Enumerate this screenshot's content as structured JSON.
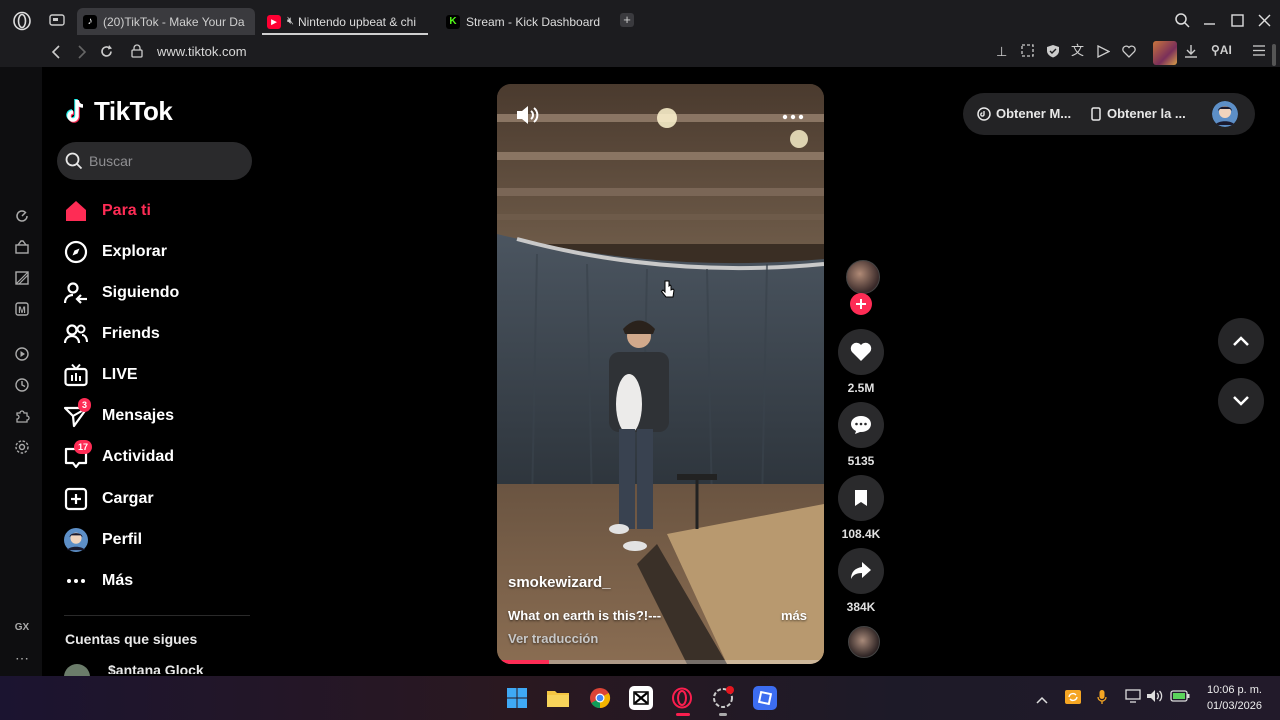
{
  "browser": {
    "tabs": [
      {
        "title": "(20)TikTok - Make Your Da",
        "active": true
      },
      {
        "title": "Nintendo upbeat & chi",
        "active": false,
        "muted": true
      },
      {
        "title": "Stream - Kick Dashboard",
        "active": false
      }
    ],
    "url": "www.tiktok.com"
  },
  "tiktok": {
    "logo_text": "TikTok",
    "search_placeholder": "Buscar",
    "nav": [
      {
        "label": "Para ti",
        "icon": "home-icon",
        "active": true
      },
      {
        "label": "Explorar",
        "icon": "compass-icon"
      },
      {
        "label": "Siguiendo",
        "icon": "following-icon"
      },
      {
        "label": "Friends",
        "icon": "friends-icon"
      },
      {
        "label": "LIVE",
        "icon": "live-icon"
      },
      {
        "label": "Mensajes",
        "icon": "messages-icon",
        "badge": "3"
      },
      {
        "label": "Actividad",
        "icon": "activity-icon",
        "badge": "17"
      },
      {
        "label": "Cargar",
        "icon": "upload-icon"
      },
      {
        "label": "Perfil",
        "icon": "avatar"
      },
      {
        "label": "Más",
        "icon": "more-icon"
      }
    ],
    "following_title": "Cuentas que sigues",
    "following_first": "$antana Glock"
  },
  "video": {
    "author": "smokewizard_",
    "caption": "What on earth is this?!---",
    "more_label": "más",
    "translate_label": "Ver traducción",
    "progress": 0.16
  },
  "actions": {
    "likes": "2.5M",
    "comments": "5135",
    "saves": "108.4K",
    "shares": "384K"
  },
  "topright": {
    "get_app": "Obtener M...",
    "get_desktop": "Obtener la ..."
  },
  "taskbar": {
    "time": "10:06 p. m.",
    "date": "01/03/2026"
  },
  "sidebar_opera": {
    "gx_label": "GX"
  },
  "colors": {
    "accent": "#fe2c55",
    "background": "#000000"
  }
}
